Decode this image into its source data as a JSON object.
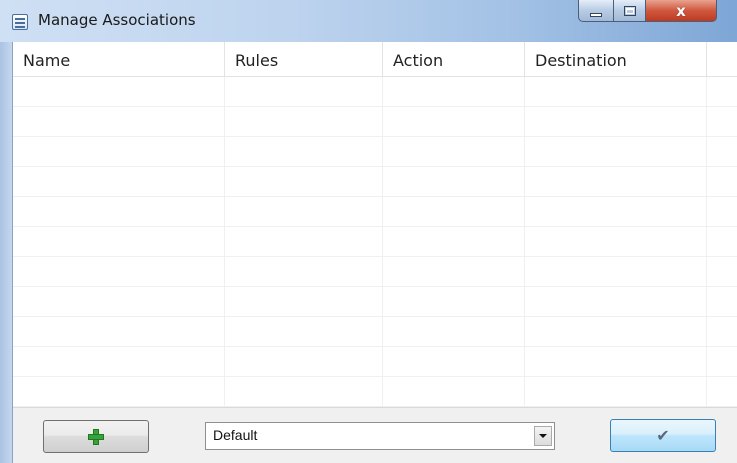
{
  "window": {
    "title": "Manage Associations",
    "close_label": "x"
  },
  "table": {
    "columns": [
      "Name",
      "Rules",
      "Action",
      "Destination"
    ],
    "rows": []
  },
  "footer": {
    "add_button_icon": "plus-icon",
    "profile_select_value": "Default",
    "ok_button_icon": "check-icon"
  },
  "colors": {
    "add_icon": "#3aa23a",
    "close_button": "#c8452d",
    "ok_button_border": "#3c7fb1"
  }
}
